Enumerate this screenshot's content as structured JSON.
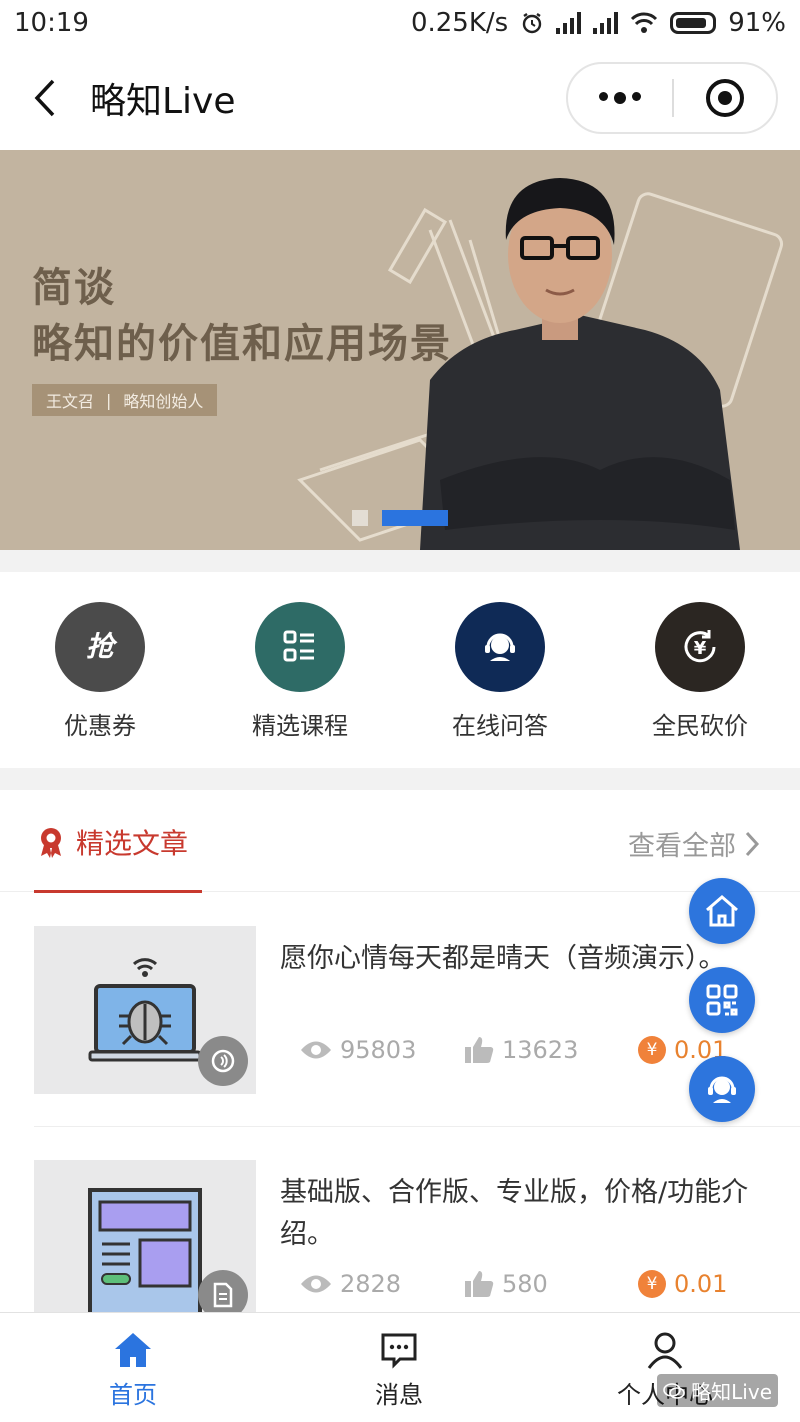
{
  "status_bar": {
    "time": "10:19",
    "speed": "0.25K/s",
    "battery": "91%"
  },
  "nav": {
    "title": "略知Live"
  },
  "banner": {
    "title_line1": "简谈",
    "title_line2": "略知的价值和应用场景",
    "tag_name": "王文召",
    "tag_sep": "|",
    "tag_role": "略知创始人"
  },
  "quick_entries": [
    {
      "label": "优惠券",
      "icon": "coupon-icon",
      "color": "#4b4b4b"
    },
    {
      "label": "精选课程",
      "icon": "course-list-icon",
      "color": "#2e6b66"
    },
    {
      "label": "在线问答",
      "icon": "headset-icon",
      "color": "#0f2a56"
    },
    {
      "label": "全民砍价",
      "icon": "yen-refresh-icon",
      "color": "#2b2622"
    }
  ],
  "articles_section": {
    "title": "精选文章",
    "see_all": "查看全部",
    "items": [
      {
        "title": "愿你心情每天都是晴天（音频演示）。",
        "views": "95803",
        "likes": "13623",
        "price": "0.01",
        "badge": "audio-icon",
        "thumb": "bug-laptop-illustration"
      },
      {
        "title": "基础版、合作版、专业版，价格/功能介绍。",
        "views": "2828",
        "likes": "580",
        "price": "0.01",
        "badge": "document-icon",
        "thumb": "layout-document-illustration"
      }
    ]
  },
  "floating_buttons": [
    "home-icon",
    "qr-code-icon",
    "customer-service-icon"
  ],
  "tab_bar": [
    {
      "label": "首页",
      "active": true
    },
    {
      "label": "消息",
      "active": false
    },
    {
      "label": "个人中心",
      "active": false
    }
  ],
  "watermark": "略知Live",
  "colors": {
    "accent_blue": "#2b74df",
    "section_red": "#c8392e",
    "price_orange": "#e8822f"
  }
}
